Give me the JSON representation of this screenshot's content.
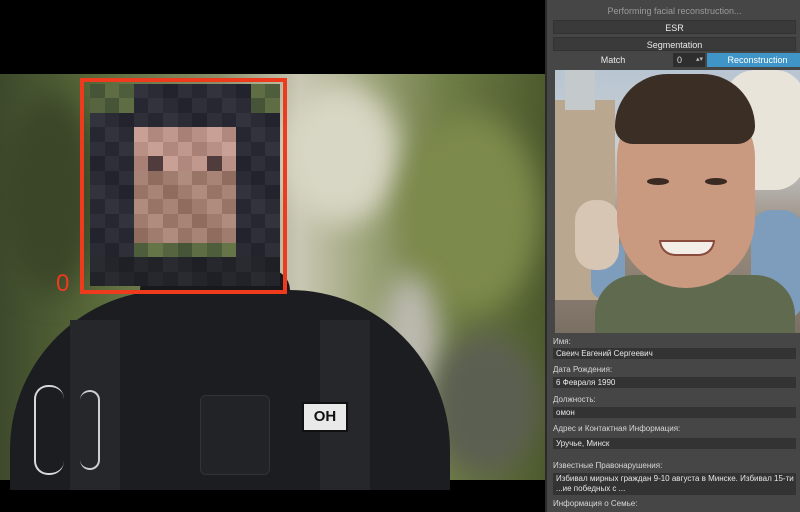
{
  "panel": {
    "status_text": "Performing facial reconstruction...",
    "esr_label": "ESR",
    "segmentation_label": "Segmentation",
    "match_label": "Match",
    "match_value": "0",
    "reconstruction_label": "Reconstruction"
  },
  "video": {
    "face_index": "0",
    "vest_patch": "ОН"
  },
  "profile": {
    "fields": [
      {
        "label": "Имя:",
        "value": "Свеич Евгений Сергеевич"
      },
      {
        "label": "Дата Рождения:",
        "value": "6 Февраля 1990"
      },
      {
        "label": "Должность:",
        "value": "омон"
      },
      {
        "label": "Адрес и Контактная Информация:",
        "value": "Уручье, Минск"
      },
      {
        "label": "Известные Правонарушения:",
        "value": "Избивал мирных граждан 9-10 августа в Минске. Избивал 15-ти ...ие победных с ..."
      },
      {
        "label": "Информация о Семье:",
        "value": ""
      }
    ]
  },
  "colors": {
    "box_accent": "#ee3b1e",
    "reconstruction_button": "#3f95c8",
    "panel_bg": "#464646"
  }
}
